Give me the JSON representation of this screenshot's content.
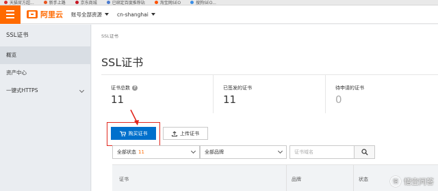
{
  "bookmarks": [
    {
      "label": "天猫官方超...",
      "color": "#d9302c"
    },
    {
      "label": "新手上路",
      "color": "#e8541e"
    },
    {
      "label": "京东商城",
      "color": "#c81623"
    },
    {
      "label": "已绑定百度推荐站",
      "color": "#4a7bd0"
    },
    {
      "label": "淘宝网SEO",
      "color": "#ff5000"
    },
    {
      "label": "搜狗SEO...",
      "color": "#3a8ee6"
    }
  ],
  "topbar": {
    "menu_icon": "hamburger-menu-icon",
    "logo_text": "阿里云",
    "account_dropdown": "账号全部资源",
    "region_dropdown": "cn-shanghai",
    "brand_color": "#ff6a00"
  },
  "sidebar": {
    "title": "SSL证书",
    "items": [
      {
        "label": "概览",
        "active": true
      },
      {
        "label": "资产中心",
        "active": false
      },
      {
        "label": "一键式HTTPS",
        "active": false,
        "expandable": true
      }
    ]
  },
  "main": {
    "breadcrumb": "SSL证书",
    "page_title": "SSL证书",
    "stats": [
      {
        "label": "证书总数",
        "value": "11",
        "help": true
      },
      {
        "label": "已签发的证书",
        "value": "11"
      },
      {
        "label": "待申请的证书",
        "value": "0"
      }
    ],
    "buy_button": "购买证书",
    "upload_button": "上传证书",
    "filters": {
      "status_label": "全部状态",
      "status_count": "11",
      "brand_label": "全部品牌",
      "search_placeholder": "证书域名"
    },
    "table_headers": [
      "证书",
      "品牌",
      "状态"
    ],
    "accent_color": "#0070cc",
    "highlight_color": "#e1251b"
  },
  "watermark": {
    "text": "悟空问答",
    "icon": "悟"
  }
}
